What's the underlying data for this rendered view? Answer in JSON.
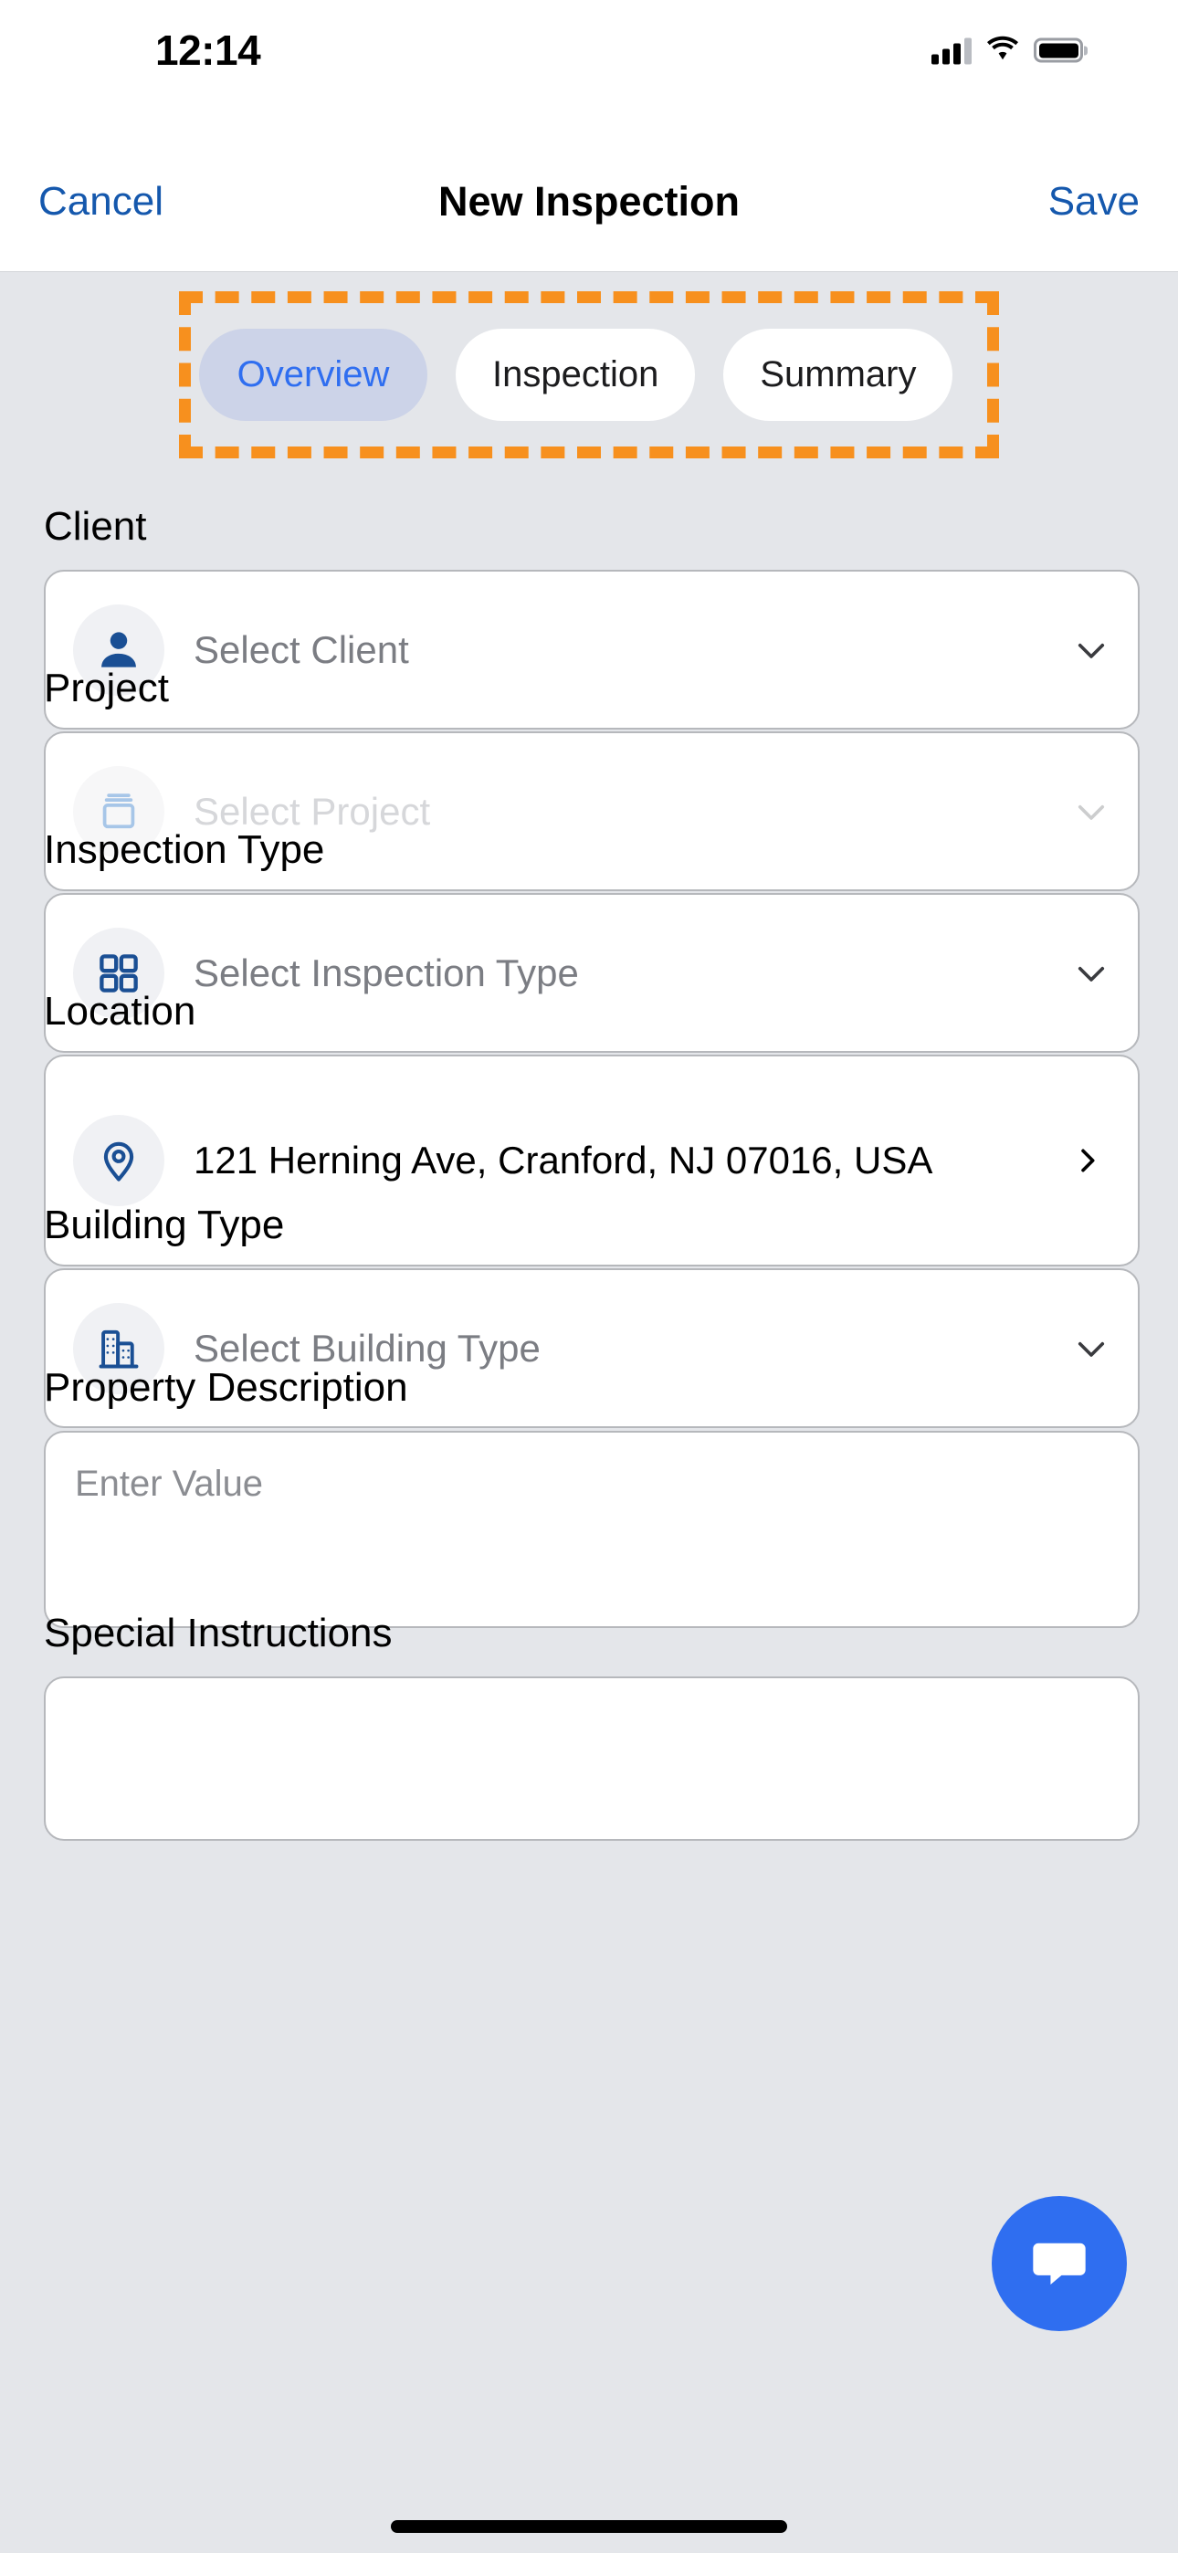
{
  "status_bar": {
    "time": "12:14",
    "cellular_icon": "cellular-signal-icon",
    "wifi_icon": "wifi-icon",
    "battery_icon": "battery-icon"
  },
  "navbar": {
    "cancel_label": "Cancel",
    "title": "New Inspection",
    "save_label": "Save"
  },
  "tabs": {
    "items": [
      {
        "label": "Overview",
        "selected": true
      },
      {
        "label": "Inspection",
        "selected": false
      },
      {
        "label": "Summary",
        "selected": false
      }
    ],
    "highlight_color": "#f7901e",
    "active_bg": "#ccd3e8",
    "active_text": "#2f6ef0"
  },
  "form": {
    "client": {
      "label": "Client",
      "placeholder": "Select Client",
      "icon": "person-icon",
      "chevron": "chevron-down-icon",
      "disabled": false
    },
    "project": {
      "label": "Project",
      "placeholder": "Select Project",
      "icon": "archive-box-icon",
      "chevron": "chevron-down-icon",
      "disabled": true
    },
    "inspection_type": {
      "label": "Inspection Type",
      "placeholder": "Select Inspection Type",
      "icon": "grid-squares-icon",
      "chevron": "chevron-down-icon",
      "disabled": false
    },
    "location": {
      "label": "Location",
      "value": "121 Herning Ave, Cranford, NJ 07016, USA",
      "icon": "map-pin-icon",
      "chevron": "chevron-right-icon"
    },
    "building_type": {
      "label": "Building Type",
      "placeholder": "Select Building Type",
      "icon": "building-icon",
      "chevron": "chevron-down-icon",
      "disabled": false
    },
    "property_description": {
      "label": "Property Description",
      "placeholder": "Enter Value",
      "value": ""
    },
    "special_instructions": {
      "label": "Special Instructions",
      "placeholder": "",
      "value": ""
    }
  },
  "chat_fab": {
    "icon": "chat-bubble-icon",
    "color": "#2f6ef0"
  },
  "theme": {
    "page_background": "#e4e6ea",
    "card_background": "#ffffff",
    "accent_blue": "#1558ad",
    "icon_blue": "#1a4f94"
  }
}
